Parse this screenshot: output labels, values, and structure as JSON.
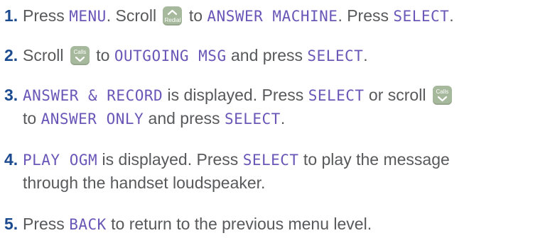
{
  "steps": [
    {
      "number": "1",
      "dot": ".",
      "t1": " Press ",
      "lcd1": "MENU",
      "t2": ". Scroll ",
      "key_label": "Redial",
      "key_icon": "chevron-up-icon",
      "t3": " to ",
      "lcd2": "ANSWER MACHINE",
      "t4": ". Press ",
      "lcd3": "SELECT",
      "t5": "."
    },
    {
      "number": "2",
      "dot": ".",
      "t1": " Scroll ",
      "key_label": "Calls",
      "key_icon": "chevron-down-icon",
      "t2": " to ",
      "lcd1": "OUTGOING MSG",
      "t3": " and press ",
      "lcd2": "SELECT",
      "t4": "."
    },
    {
      "number": "3",
      "dot": ".",
      "lcd1": "ANSWER & RECORD",
      "t1": " is displayed. Press ",
      "lcd2": "SELECT",
      "t2": " or scroll ",
      "key_label": "Calls",
      "key_icon": "chevron-down-icon",
      "t3": "to ",
      "lcd3": "ANSWER ONLY",
      "t4": " and press ",
      "lcd4": "SELECT",
      "t5": "."
    },
    {
      "number": "4",
      "dot": ".",
      "lcd1": "PLAY OGM",
      "t1": " is displayed. Press ",
      "lcd2": "SELECT",
      "t2": " to play the message",
      "t3": "through the handset loudspeaker."
    },
    {
      "number": "5",
      "dot": ".",
      "t1": " Press ",
      "lcd1": "BACK",
      "t2": " to return to the previous menu level."
    }
  ],
  "colors": {
    "number": "#1b4a8f",
    "lcd_text": "#6a56b7",
    "body_text": "#58595b",
    "key_bg": "#a7b99c"
  }
}
